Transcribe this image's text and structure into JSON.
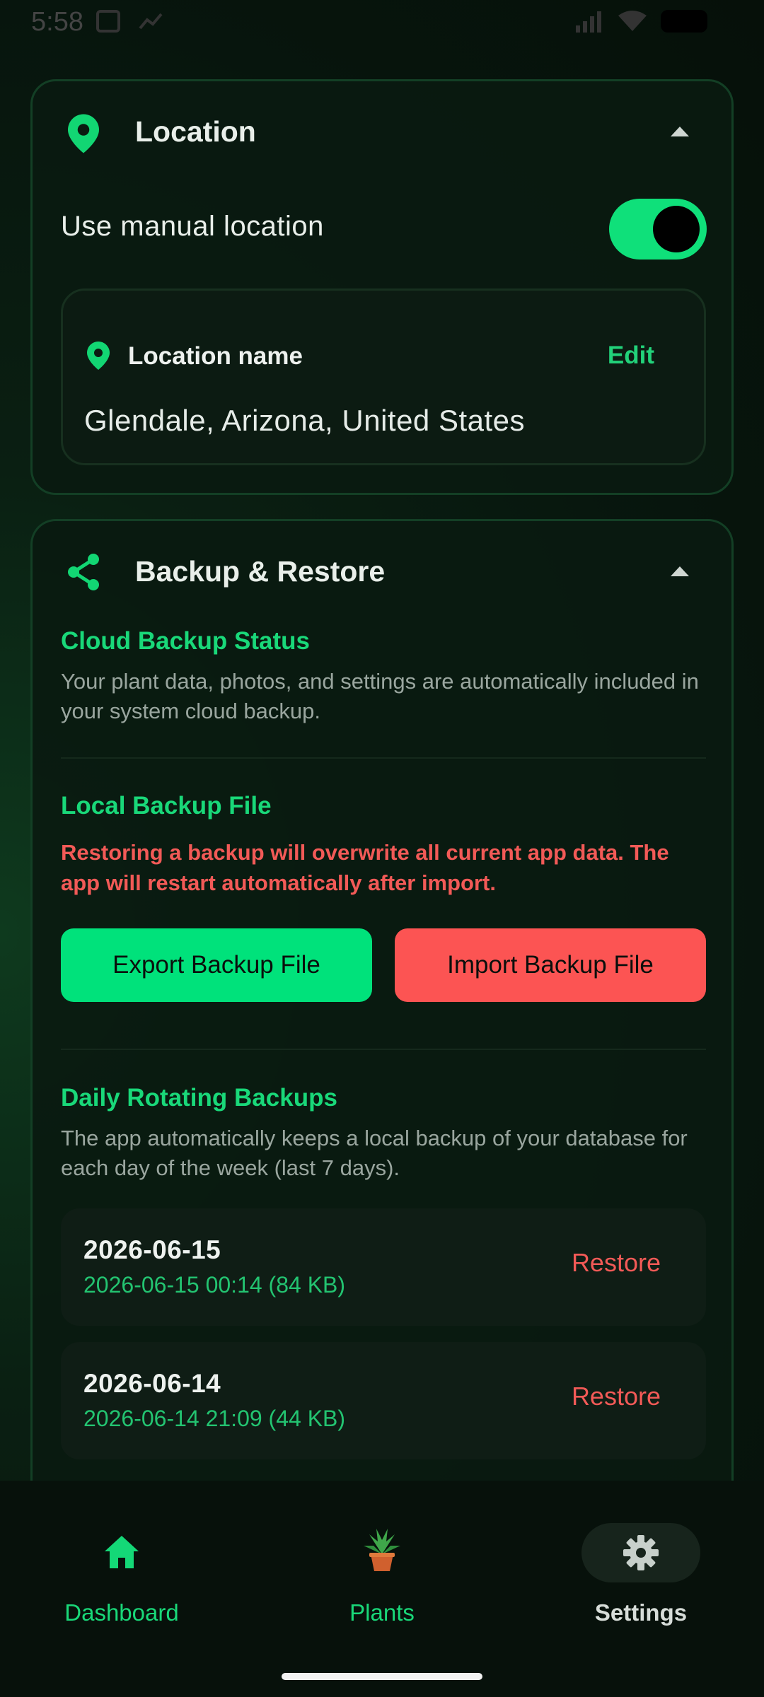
{
  "status_bar": {
    "time": "5:58"
  },
  "location_card": {
    "title": "Location",
    "icon": "map-pin-icon",
    "toggle_label": "Use manual location",
    "toggle_on": true,
    "location_name_label": "Location name",
    "edit_label": "Edit",
    "location_value": "Glendale, Arizona, United States"
  },
  "backup_card": {
    "title": "Backup & Restore",
    "icon": "share-icon",
    "cloud_title": "Cloud Backup Status",
    "cloud_desc": "Your plant data, photos, and settings are automatically included in your system cloud backup.",
    "local_title": "Local Backup File",
    "local_warning": "Restoring a backup will overwrite all current app data. The app will restart automatically after import.",
    "export_label": "Export Backup File",
    "import_label": "Import Backup File",
    "daily_title": "Daily Rotating Backups",
    "daily_desc": "The app automatically keeps a local backup of your database for each day of the week (last 7 days).",
    "backups": [
      {
        "date": "2026-06-15",
        "meta": "2026-06-15 00:14 (84 KB)",
        "action": "Restore"
      },
      {
        "date": "2026-06-14",
        "meta": "2026-06-14 21:09 (44 KB)",
        "action": "Restore"
      }
    ]
  },
  "nav": {
    "items": [
      {
        "label": "Dashboard",
        "icon": "home-icon"
      },
      {
        "label": "Plants",
        "icon": "potted-plant-icon"
      },
      {
        "label": "Settings",
        "icon": "gear-icon",
        "selected": true
      }
    ]
  },
  "colors": {
    "accent": "#00e27b",
    "danger": "#fc5453",
    "background": "#07150d"
  }
}
